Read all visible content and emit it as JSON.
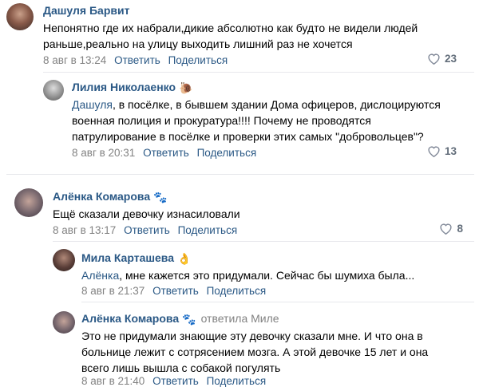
{
  "comments": [
    {
      "author": "Дашуля Барвит",
      "text_lines": [
        "Непонятно где их набрали,дикие абсолютно как будто не видели людей",
        "раньше,реально на улицу выходить лишний раз не хочется"
      ],
      "date": "8 авг в 13:24",
      "reply": "Ответить",
      "share": "Поделиться",
      "likes": "23"
    },
    {
      "author": "Лилия Николаенко",
      "badge": "🐌",
      "mention": "Дашуля",
      "text_lines": [
        ", в посёлке, в бывшем здании Дома офицеров, дислоцируются",
        "военная полиция и прокуратура!!!! Почему не проводятся",
        "патрулирование в посёлке и проверки этих самых \"добровольцев\"?"
      ],
      "date": "8 авг в 20:31",
      "reply": "Ответить",
      "share": "Поделиться",
      "likes": "13"
    },
    {
      "author": "Алёнка Комарова",
      "badge": "🐾",
      "text_lines": [
        "Ещё сказали девочку изнасиловали"
      ],
      "date": "8 авг в 13:17",
      "reply": "Ответить",
      "share": "Поделиться",
      "likes": "8"
    },
    {
      "author": "Мила Карташева",
      "badge": "👌",
      "mention": "Алёнка",
      "text_lines": [
        ", мне кажется это придумали. Сейчас бы шумиха была..."
      ],
      "date": "8 авг в 21:37",
      "reply": "Ответить",
      "share": "Поделиться"
    },
    {
      "author": "Алёнка Комарова",
      "badge": "🐾",
      "replied_to": "ответила Миле",
      "text_lines": [
        "Это не придумали знающие эту девочку сказали мне. И что она в",
        "больнице лежит с сотрясением мозга. А этой девочке 15 лет и она",
        "всего лишь вышла с собакой погулять"
      ],
      "date": "8 авг в 21:40",
      "reply": "Ответить",
      "share": "Поделиться"
    }
  ],
  "colors": {
    "link": "#2a5885",
    "meta": "#828282",
    "like": "#626d7a"
  }
}
